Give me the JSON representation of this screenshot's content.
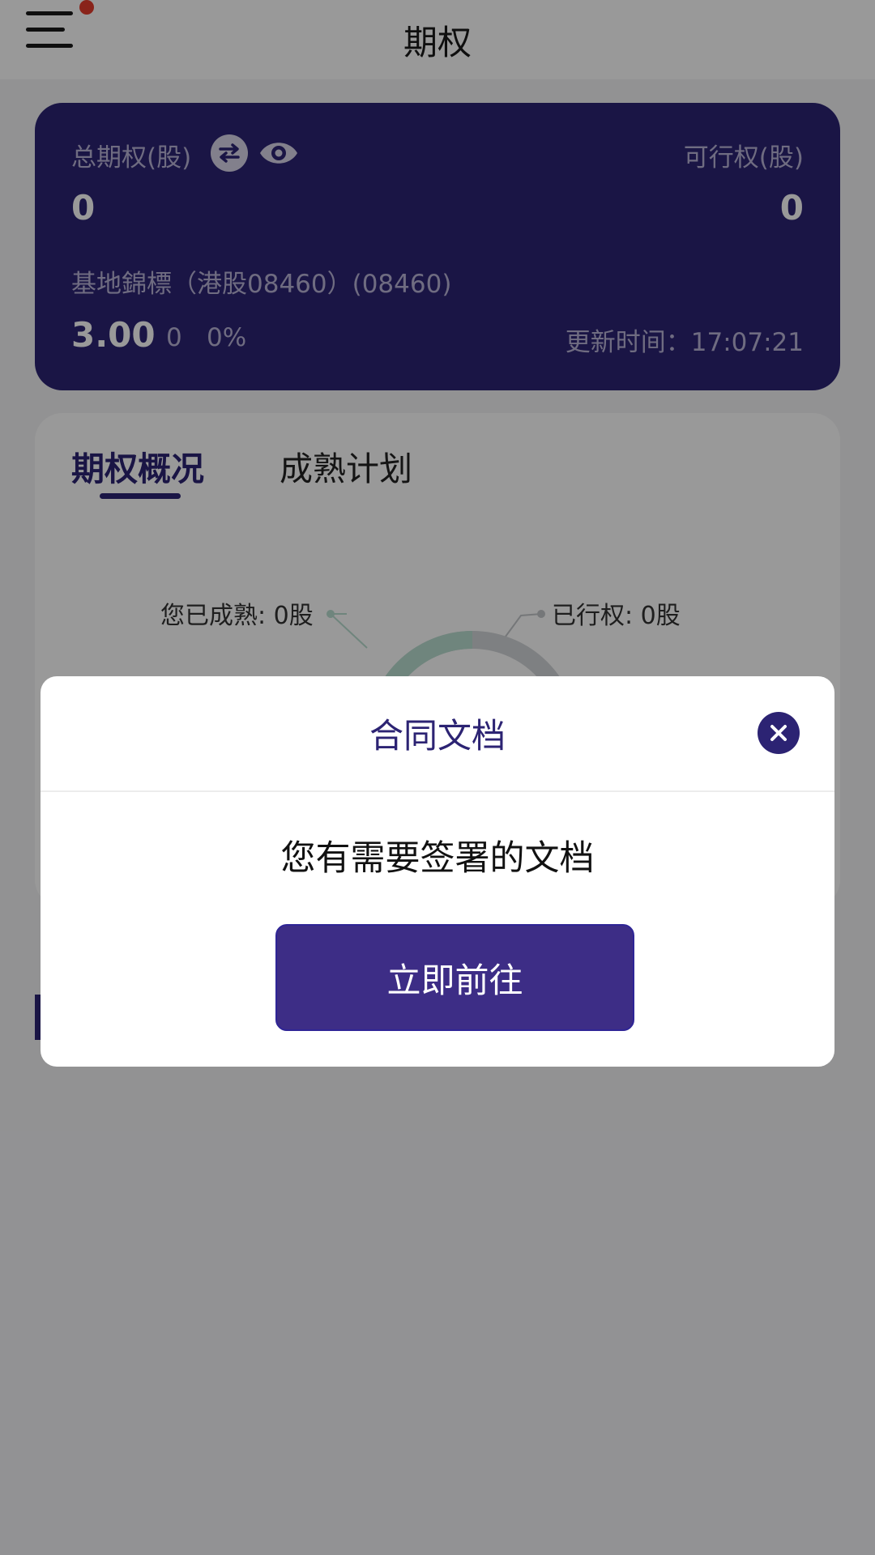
{
  "header": {
    "title": "期权",
    "menu_icon": "hamburger-menu-icon",
    "notification_color": "#e53b2c"
  },
  "card": {
    "total_label": "总期权(股)",
    "total_value": "0",
    "exercisable_label": "可行权(股)",
    "exercisable_value": "0",
    "stock_name": "基地錦標（港股08460）(08460)",
    "price": "3.00",
    "change": "0",
    "change_pct": "0%",
    "update_time": "更新时间：17:07:21",
    "icons": [
      "swap-icon",
      "eye-icon"
    ],
    "background_color": "#2c2373"
  },
  "overview": {
    "tabs": [
      {
        "label": "期权概况",
        "active": true
      },
      {
        "label": "成熟计划",
        "active": false
      }
    ],
    "legend_matured": "您已成熟: 0股",
    "legend_exercised": "已行权: 0股",
    "donut_colors": {
      "matured": "#b9ded0",
      "exercised": "#d3d6d9"
    }
  },
  "modal": {
    "title": "合同文档",
    "message": "您有需要签署的文档",
    "button_label": "立即前往",
    "close_icon": "close-icon",
    "accent_color": "#2c2373"
  }
}
